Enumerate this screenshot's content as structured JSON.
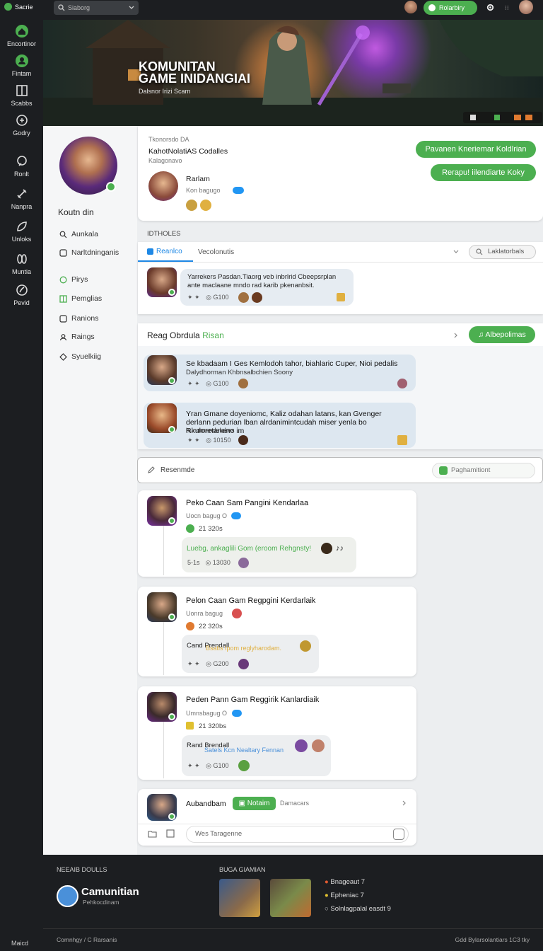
{
  "rail": {
    "top_label": "Sacrie",
    "items": [
      {
        "label": "Encortinor",
        "icon": "home-icon"
      },
      {
        "label": "Fintam",
        "icon": "user-icon"
      },
      {
        "label": "Scabbs",
        "icon": "book-icon"
      },
      {
        "label": "Godry",
        "icon": "gamepad-icon"
      },
      {
        "label": "Ronlt",
        "icon": "shield-icon"
      },
      {
        "label": "Nanpra",
        "icon": "sword-icon"
      },
      {
        "label": "Unloks",
        "icon": "leaf-icon"
      },
      {
        "label": "Muntia",
        "icon": "chat-icon"
      },
      {
        "label": "Pevid",
        "icon": "globe-icon"
      }
    ],
    "bottom_label": "Maicd"
  },
  "topbar": {
    "search_placeholder": "Siaborg",
    "cta_label": "Rolarbiry"
  },
  "banner": {
    "title_line1": "KOMUNITAN",
    "title_line2": "GAME INIDANGIAI",
    "subtitle": "Dalsnor Irizi Scarn"
  },
  "profile": {
    "name": "Koutn din",
    "header_small": "Tkonorsdo DA",
    "header_title": "KahotNolatiAS Codalles",
    "header_sub": "Kalagonavo",
    "member_name": "Rarlam",
    "member_sub": "Kon bagugo",
    "btn_primary": "Pavanen Kneriemar Koldlrian",
    "btn_secondary": "Rerapu! iilendiarte Koky"
  },
  "sidebar": {
    "items": [
      {
        "label": "Aunkala",
        "icon": "search-icon"
      },
      {
        "label": "Narltdninganis",
        "icon": "inbox-icon"
      },
      {
        "label": "Pirys",
        "icon": "circle-icon"
      },
      {
        "label": "Pemglias",
        "icon": "grid-icon"
      },
      {
        "label": "Ranions",
        "icon": "list-icon"
      },
      {
        "label": "Raings",
        "icon": "users-icon"
      },
      {
        "label": "Syuelkiig",
        "icon": "diamond-icon"
      }
    ]
  },
  "section1": {
    "heading": "IDTHOLES",
    "tab_active": "Reanlco",
    "tab_other": "Vecolonutis",
    "search": "Laklatorbals",
    "bubble": "Yarrekers Pasdan.Tiaorg veb inbrlrid Cbeepsrplan ante maclaane mndo rad karib pkenanbsit.",
    "count": "G100"
  },
  "section2": {
    "heading": "Reag Obrdula",
    "heading_accent": "Risan",
    "button": "Albepolimas",
    "posts": [
      {
        "text": "Se kbadaam I Ges Kemlodoh tahor, biahlaric Cuper, Nioi pedalis",
        "sub": "Dalydhorman Khbnsalbchien Soony",
        "count": "G100"
      },
      {
        "text": "Yran Gmane doyeniomc, Kaliz odahan latans, kan Gvenger derlann pedurian lban alrdanimintcudah miser yenla bo Rkuloretanano im",
        "sub": "hunomerolelakes",
        "count": "10150"
      }
    ]
  },
  "composer": {
    "placeholder": "Resenmde",
    "button": "Paghamitiont"
  },
  "feed": [
    {
      "title": "Peko Caan Sam Pangini Kendarlaa",
      "sub": "Uocn bagug O",
      "stat": "21 320s",
      "bubble_title": "Luebg, ankaglili Gom (eroom Rehgnsty!",
      "meta": "5-1s",
      "count": "13030"
    },
    {
      "title": "Pelon Caan Gam Regpgini Kerdarlaik",
      "sub": "Uonra bagug",
      "stat": "22 320s",
      "bubble_title": "Cand Prendall",
      "bubble_sub": "Bsatis Ipom reglyharodam.",
      "count": "G200"
    },
    {
      "title": "Peden Pann Gam Reggirik Kanlardiaik",
      "sub": "Umnsbagug O",
      "stat": "21 320bs",
      "bubble_title": "Rand Brendall",
      "bubble_sub": "Satels Kcn Nealtary Fennan",
      "count": "G100"
    }
  ],
  "chat": {
    "name": "Aubandbam",
    "badge": "Notaim",
    "extra": "Damacars",
    "input_placeholder": "Wes Taragenne"
  },
  "footer": {
    "col1_title": "NEEAIB DOULLS",
    "brand": "Camunitian",
    "brand_sub": "Pehkocdinam",
    "col2_title": "BUGA GIAMIAN",
    "links": [
      "Bnageaut 7",
      "Epheniac 7",
      "Solnlagpalal easdt 9"
    ],
    "bottom_left": "Comnhgy / C Rarsanis",
    "bottom_right": "Gdd Bylarsolantiars  1C3  tky"
  }
}
